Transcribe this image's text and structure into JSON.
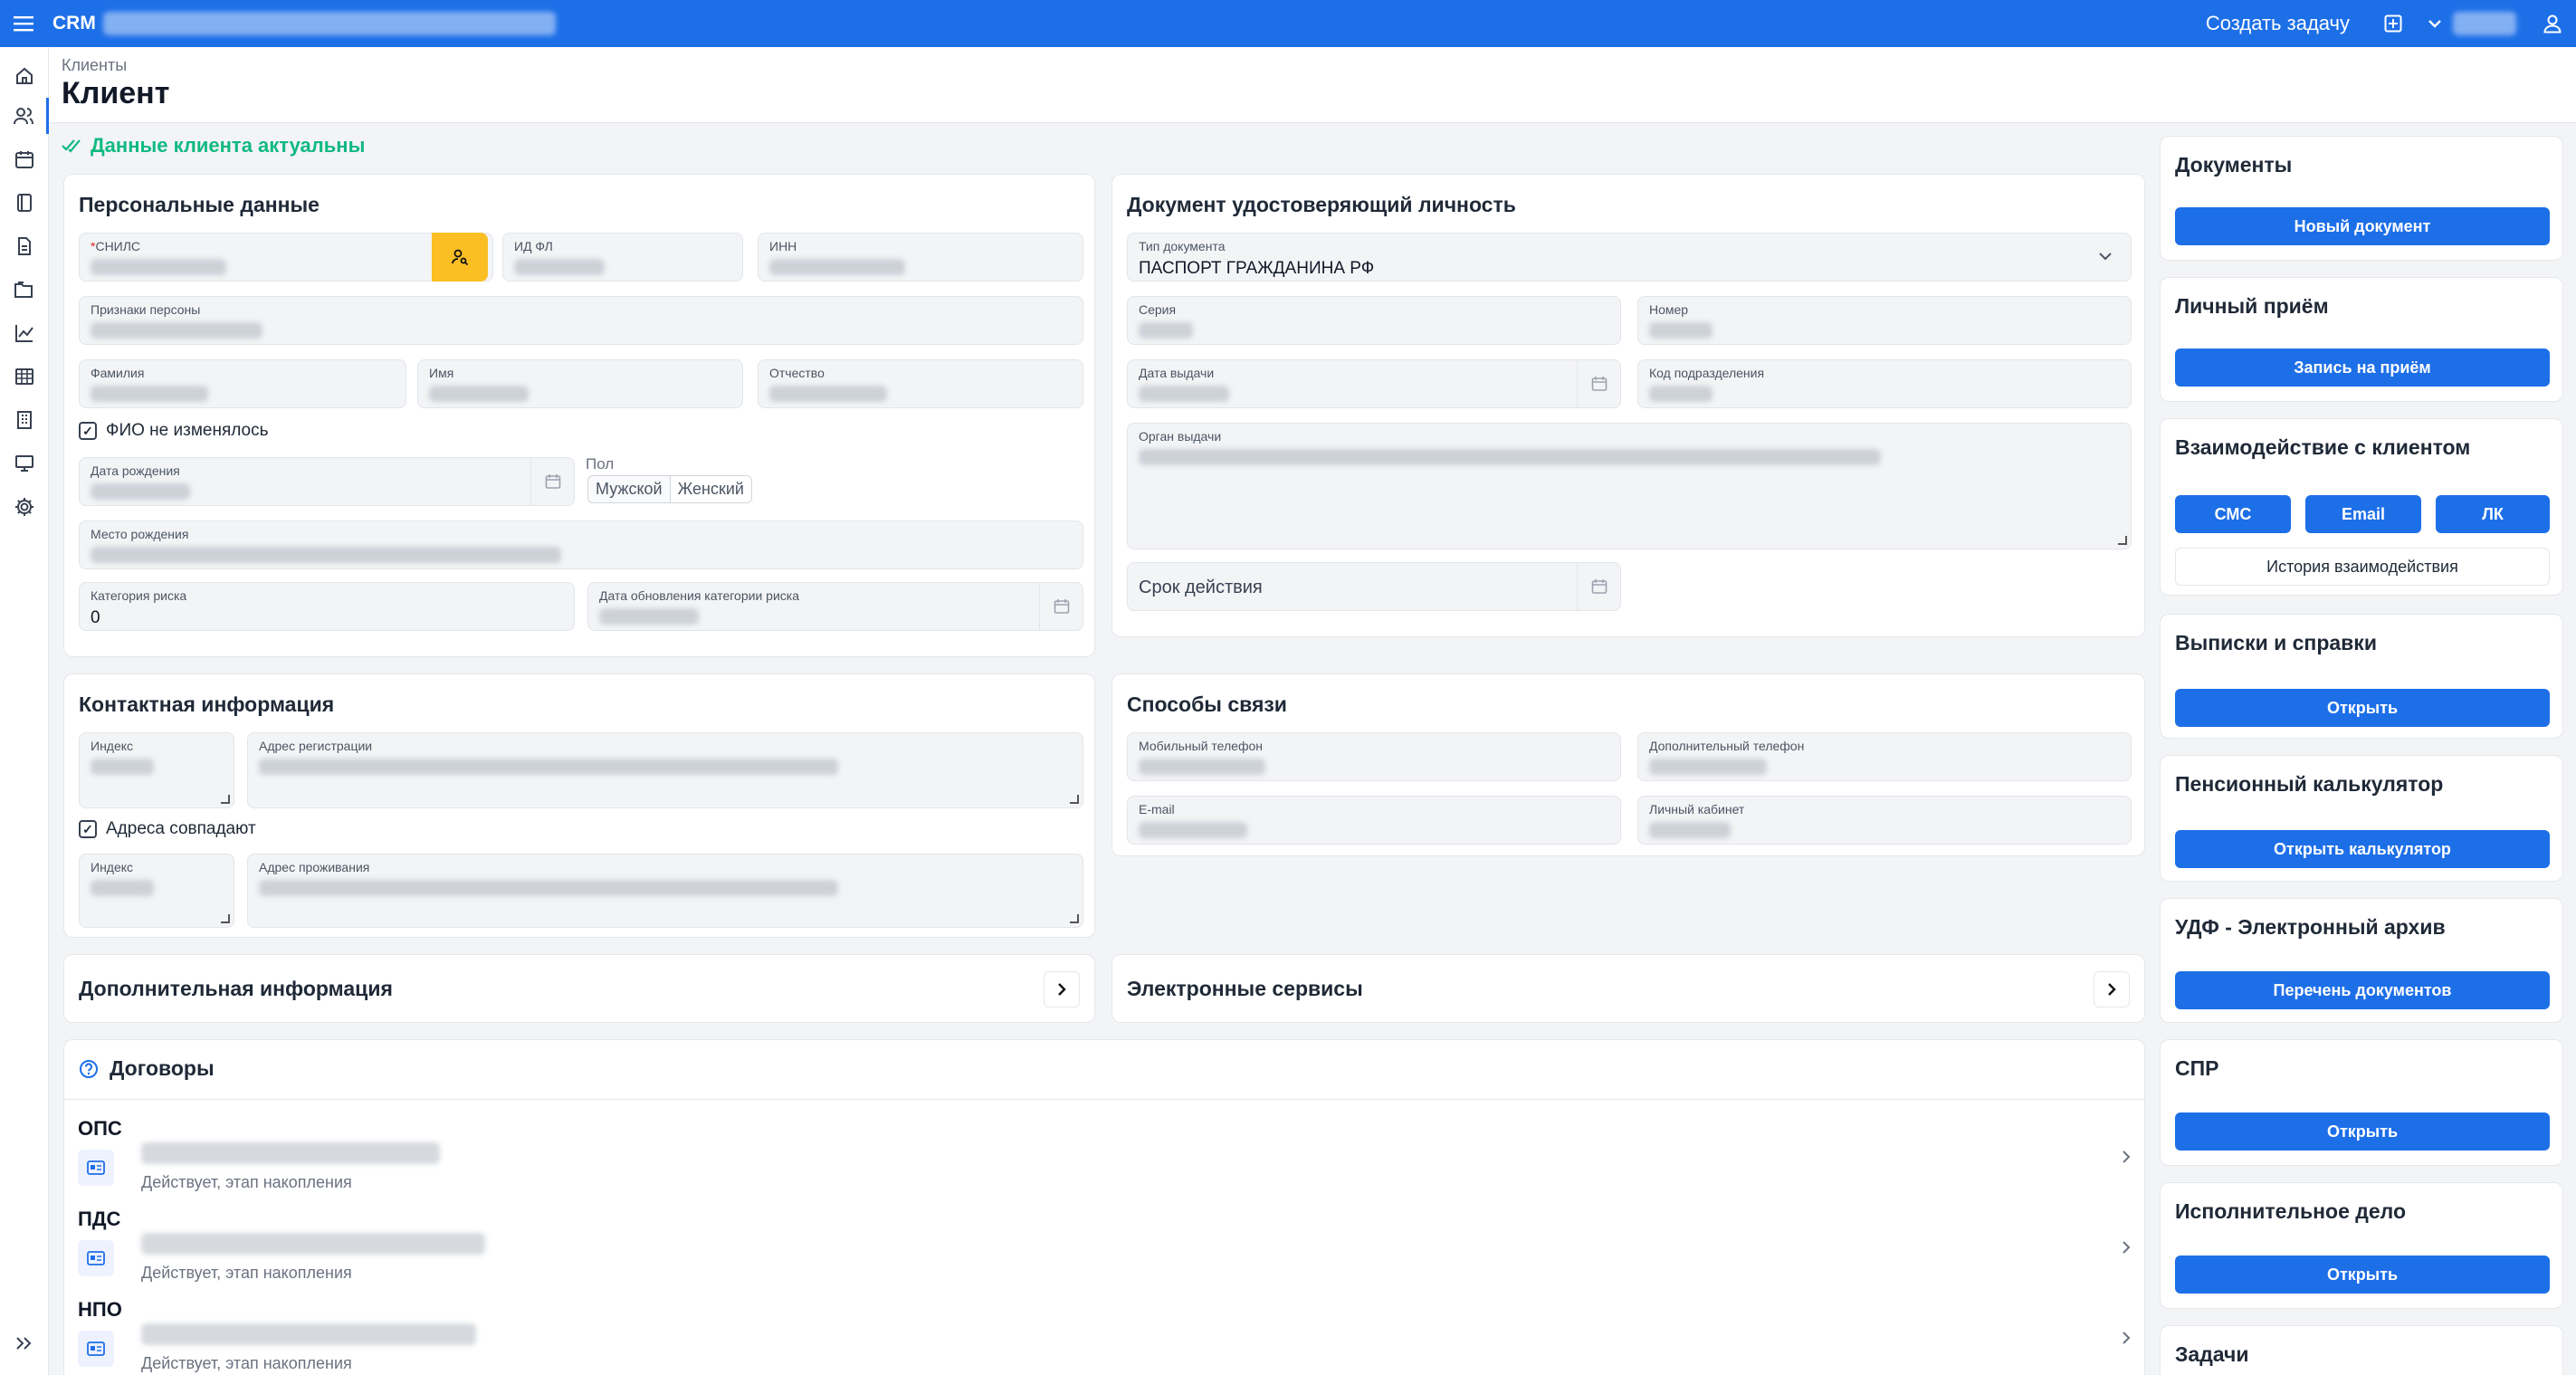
{
  "app": {
    "name": "CRM"
  },
  "topbar": {
    "create_task": "Создать задачу"
  },
  "breadcrumb": "Клиенты",
  "page_title": "Клиент",
  "status_text": "Данные клиента актуальны",
  "personal": {
    "title": "Персональные данные",
    "snils_label": "СНИЛС",
    "idfl_label": "ИД ФЛ",
    "inn_label": "ИНН",
    "signs_label": "Признаки персоны",
    "lastname_label": "Фамилия",
    "firstname_label": "Имя",
    "middlename_label": "Отчество",
    "fio_unchanged": "ФИО не изменялось",
    "birthdate_label": "Дата рождения",
    "gender_label": "Пол",
    "gender_male": "Мужской",
    "gender_female": "Женский",
    "birthplace_label": "Место рождения",
    "risk_label": "Категория риска",
    "risk_value": "0",
    "risk_date_label": "Дата обновления категории риска"
  },
  "document": {
    "title": "Документ удостоверяющий личность",
    "type_label": "Тип документа",
    "type_value": "ПАСПОРТ ГРАЖДАНИНА РФ",
    "series_label": "Серия",
    "number_label": "Номер",
    "issue_date_label": "Дата выдачи",
    "dept_code_label": "Код подразделения",
    "issuer_label": "Орган выдачи",
    "validity_placeholder": "Срок действия"
  },
  "contact": {
    "title": "Контактная информация",
    "index_label": "Индекс",
    "reg_address_label": "Адрес регистрации",
    "same_address": "Адреса совпадают",
    "index2_label": "Индекс",
    "live_address_label": "Адрес проживания"
  },
  "comm": {
    "title": "Способы связи",
    "mobile_label": "Мобильный телефон",
    "extra_phone_label": "Дополнительный телефон",
    "email_label": "E-mail",
    "cabinet_label": "Личный кабинет"
  },
  "additional_info": "Дополнительная информация",
  "e_services": "Электронные сервисы",
  "contracts": {
    "title": "Договоры",
    "items": [
      {
        "name": "ОПС",
        "status": "Действует, этап накопления"
      },
      {
        "name": "ПДС",
        "status": "Действует, этап накопления"
      },
      {
        "name": "НПО",
        "status": "Действует, этап накопления"
      }
    ]
  },
  "right": {
    "documents": {
      "title": "Документы",
      "button": "Новый документ"
    },
    "reception": {
      "title": "Личный приём",
      "button": "Запись на приём"
    },
    "interaction": {
      "title": "Взаимодействие с клиентом",
      "sms": "СМС",
      "email": "Email",
      "lk": "ЛК",
      "history": "История взаимодействия"
    },
    "statements": {
      "title": "Выписки и справки",
      "button": "Открыть"
    },
    "pension": {
      "title": "Пенсионный калькулятор",
      "button": "Открыть калькулятор"
    },
    "udf": {
      "title": "УДФ - Электронный архив",
      "button": "Перечень документов"
    },
    "spr": {
      "title": "СПР",
      "button": "Открыть"
    },
    "enforcement": {
      "title": "Исполнительное дело",
      "button": "Открыть"
    },
    "tasks": {
      "title": "Задачи"
    }
  },
  "colors": {
    "accent": "#1d6fe8",
    "success": "#10b981",
    "snils_button": "#fbbf24"
  }
}
